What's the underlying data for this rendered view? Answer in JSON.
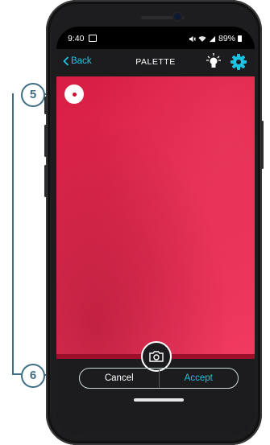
{
  "status_bar": {
    "time": "9:40",
    "battery": "89%"
  },
  "nav": {
    "back_label": "Back",
    "title": "PALETTE"
  },
  "controls": {
    "cancel_label": "Cancel",
    "accept_label": "Accept"
  },
  "callouts": {
    "target_marker": "5",
    "buttons": "6"
  },
  "colors": {
    "accent": "#1cc3e3",
    "sample": "#e22c51",
    "callout": "#3f6f86"
  },
  "icons": [
    "back-chevron-icon",
    "lightbulb-icon",
    "gear-icon",
    "camera-icon",
    "target-marker",
    "image-icon",
    "mute-icon",
    "wifi-icon",
    "signal-icon",
    "battery-icon"
  ]
}
